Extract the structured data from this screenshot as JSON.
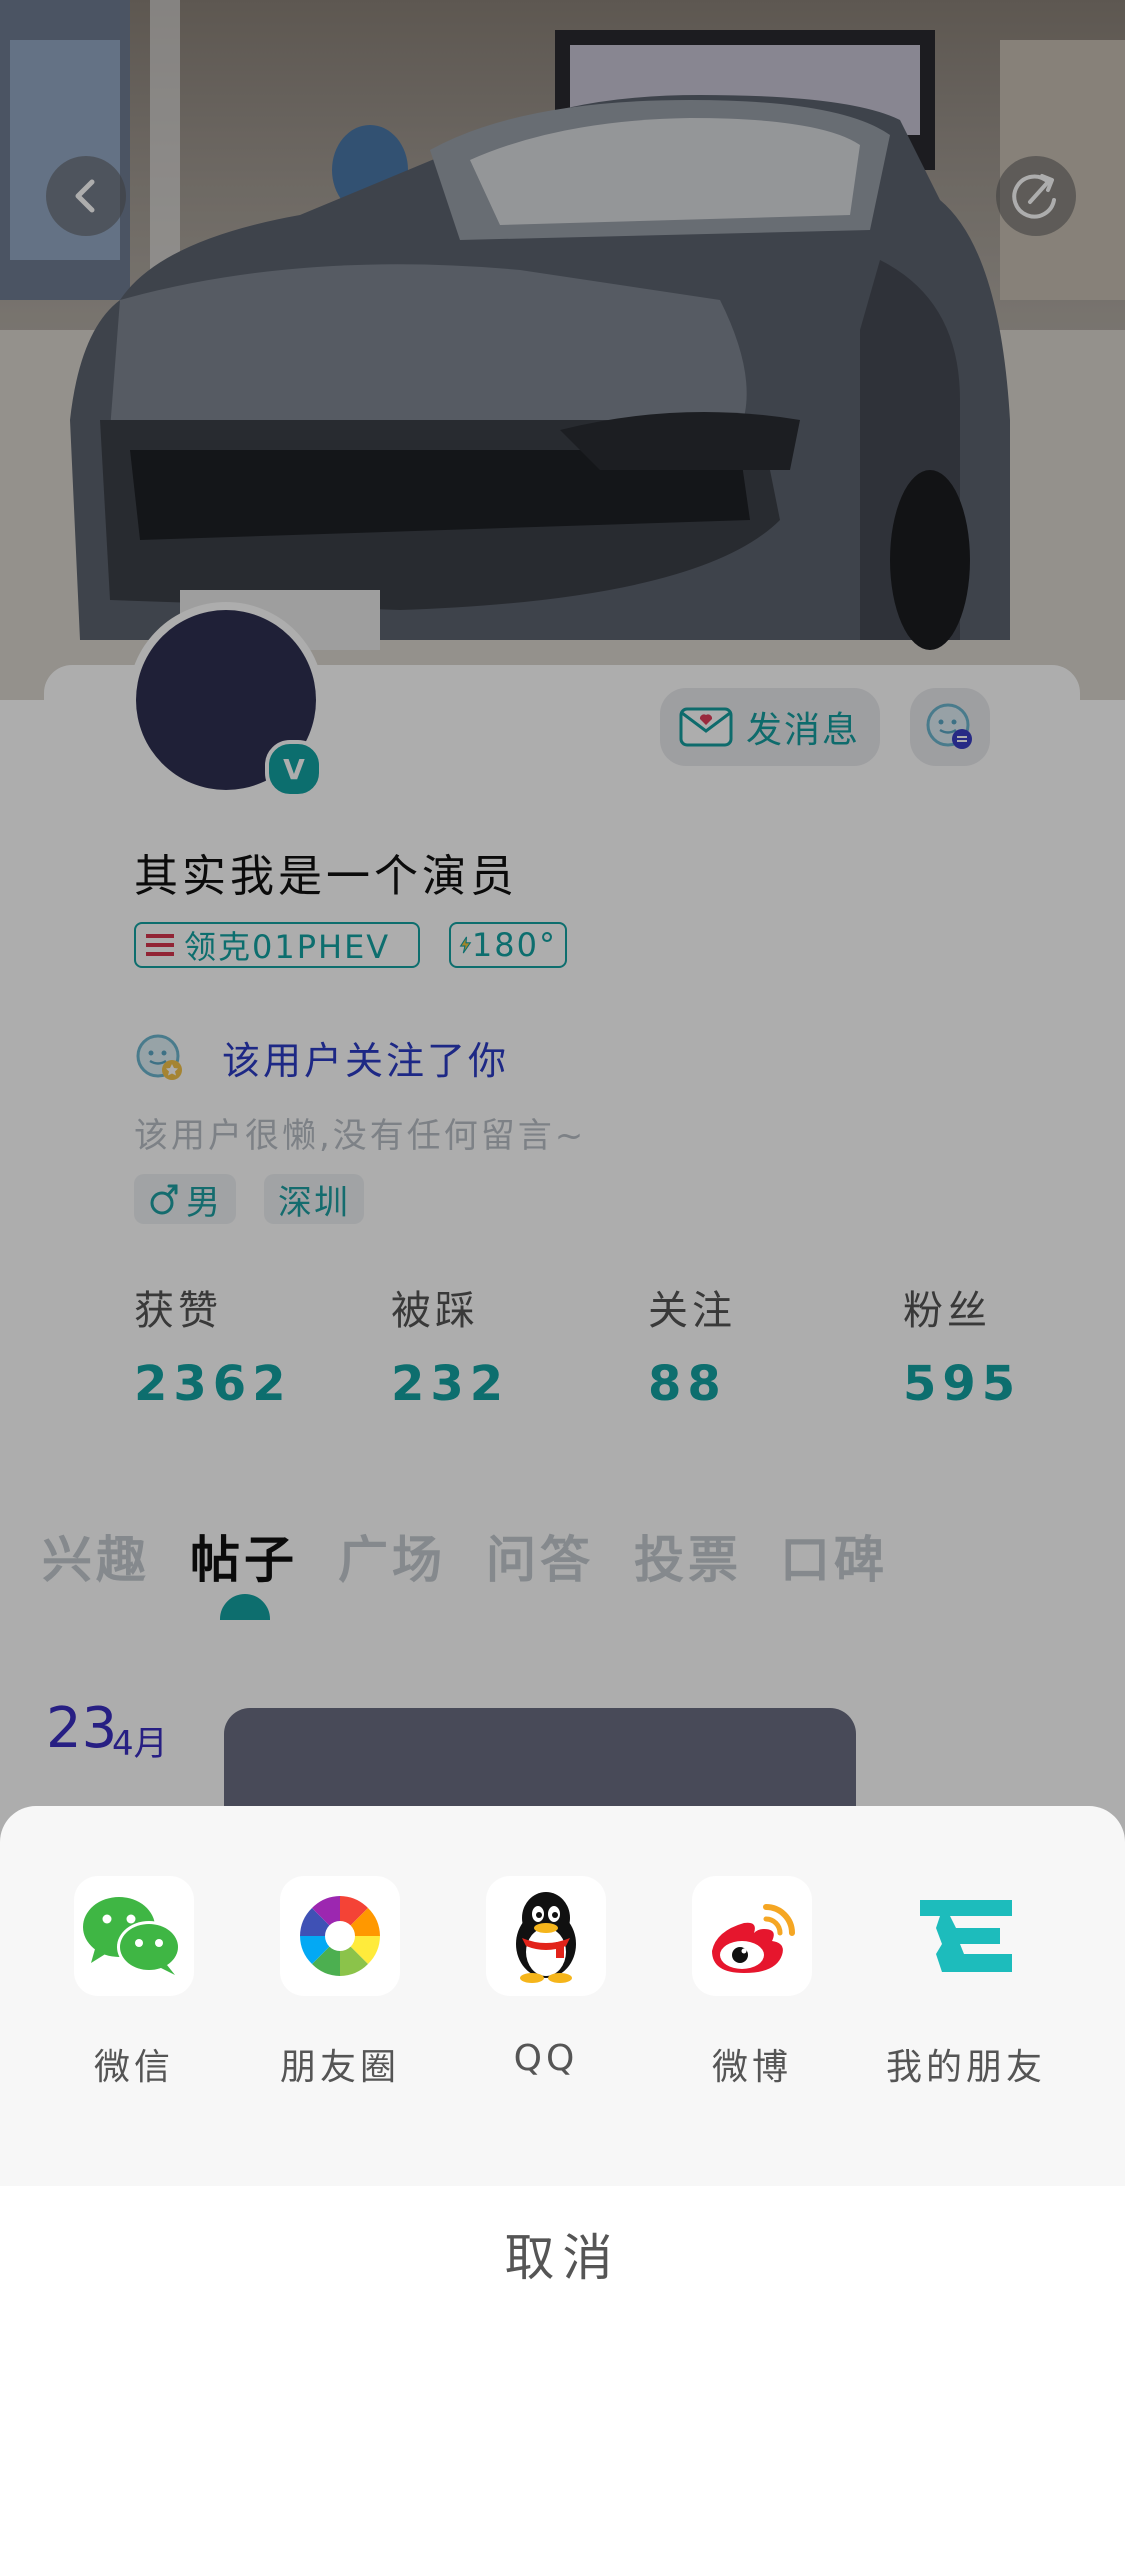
{
  "header": {
    "back_icon": "chevron-left-icon",
    "share_icon": "share-arrow-icon"
  },
  "profile": {
    "message_button": "发消息",
    "username": "其实我是一个演员",
    "car_tag": "领克01PHEV",
    "score_tag": "180°",
    "follow_notice": "该用户关注了你",
    "bio": "该用户很懒,没有任何留言~",
    "gender": "男",
    "city": "深圳"
  },
  "stats": [
    {
      "label": "获赞",
      "value": "2362"
    },
    {
      "label": "被踩",
      "value": "232"
    },
    {
      "label": "关注",
      "value": "88"
    },
    {
      "label": "粉丝",
      "value": "595"
    }
  ],
  "tabs": [
    {
      "label": "兴趣",
      "active": false
    },
    {
      "label": "帖子",
      "active": true
    },
    {
      "label": "广场",
      "active": false
    },
    {
      "label": "问答",
      "active": false
    },
    {
      "label": "投票",
      "active": false
    },
    {
      "label": "口碑",
      "active": false
    }
  ],
  "post": {
    "day": "23",
    "month": "4月"
  },
  "share_sheet": {
    "items": [
      {
        "label": "微信",
        "icon": "wechat-icon"
      },
      {
        "label": "朋友圈",
        "icon": "moments-icon"
      },
      {
        "label": "QQ",
        "icon": "qq-icon"
      },
      {
        "label": "微博",
        "icon": "weibo-icon"
      },
      {
        "label": "我的朋友",
        "icon": "my-friends-icon"
      }
    ],
    "cancel": "取消"
  },
  "colors": {
    "accent": "#14a3a3",
    "follow_text": "#2b3cc4",
    "avatar": "#2e3052"
  }
}
